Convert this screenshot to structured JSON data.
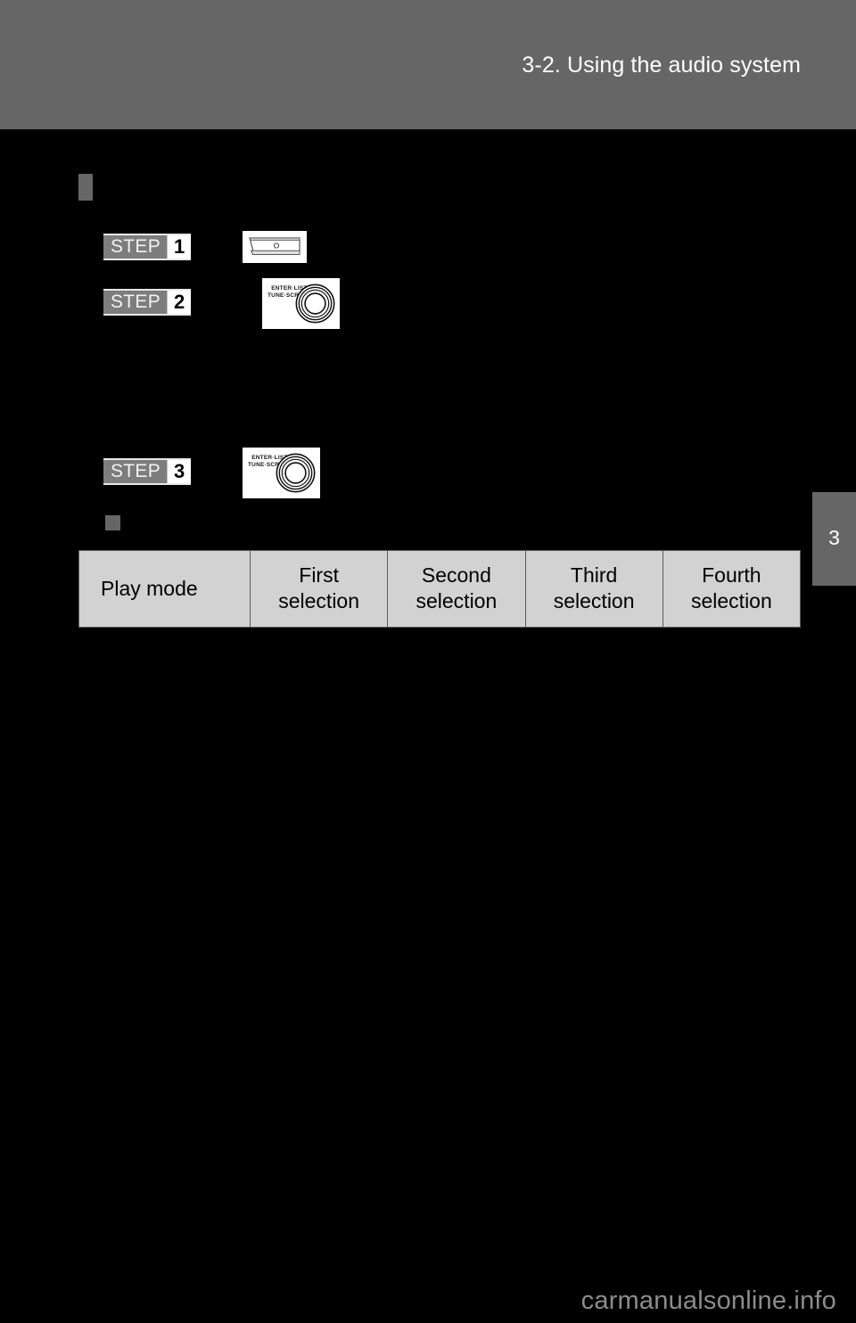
{
  "header": {
    "title": "3-2. Using the audio system"
  },
  "chapter_tab": {
    "number": "3"
  },
  "steps": [
    {
      "word": "STEP",
      "number": "1",
      "figure": {
        "name": "eject-slot-button",
        "label": ""
      }
    },
    {
      "word": "STEP",
      "number": "2",
      "figure": {
        "name": "enter-list-tune-scroll-knob",
        "label_line1": "ENTER·LIST",
        "label_line2": "TUNE·SCROLL"
      }
    },
    {
      "word": "STEP",
      "number": "3",
      "figure": {
        "name": "enter-list-tune-scroll-knob",
        "label_line1": "ENTER·LIST",
        "label_line2": "TUNE·SCROLL"
      }
    }
  ],
  "table": {
    "headers": [
      "Play mode",
      "First\nselection",
      "Second\nselection",
      "Third\nselection",
      "Fourth\nselection"
    ],
    "header_lines": {
      "col0": "Play mode",
      "col1_a": "First",
      "col1_b": "selection",
      "col2_a": "Second",
      "col2_b": "selection",
      "col3_a": "Third",
      "col3_b": "selection",
      "col4_a": "Fourth",
      "col4_b": "selection"
    },
    "rows": []
  },
  "watermark": {
    "text": "carmanualsonline.info"
  },
  "colors": {
    "header_band": "#666666",
    "page_background": "#000000",
    "table_cell": "#d2d2d2",
    "step_badge": "#7d7d7d",
    "watermark": "#8c8c8c"
  }
}
